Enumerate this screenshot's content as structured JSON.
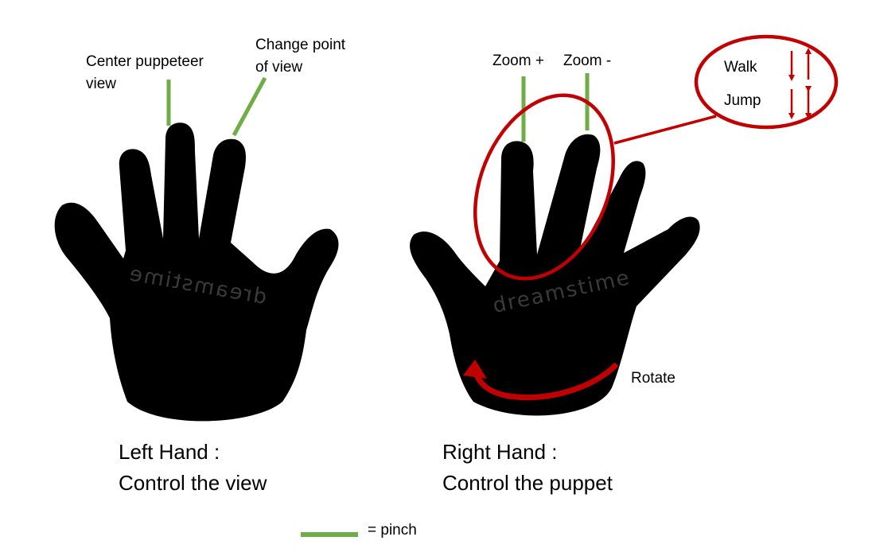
{
  "labels": {
    "center_view": "Center puppeteer\nview",
    "change_pov": "Change point\nof view",
    "zoom_plus": "Zoom +",
    "zoom_minus": "Zoom -",
    "walk": "Walk",
    "jump": "Jump",
    "rotate": "Rotate"
  },
  "captions": {
    "left_title": "Left Hand :",
    "left_desc": "Control the view",
    "right_title": "Right Hand :",
    "right_desc": "Control the puppet"
  },
  "legend": {
    "pinch": "= pinch"
  },
  "watermark": "dreamstime",
  "colors": {
    "pinch": "#70ad47",
    "action": "#c00000",
    "hand": "#000000",
    "background": "#ffffff"
  }
}
